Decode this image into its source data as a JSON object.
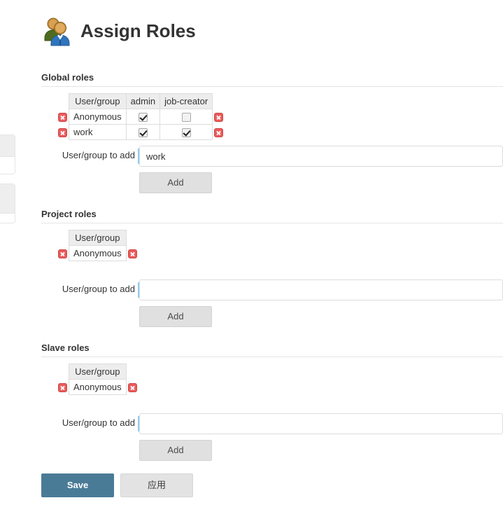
{
  "page": {
    "title": "Assign Roles",
    "icon": "users-group-icon"
  },
  "sections": [
    {
      "id": "global",
      "title": "Global roles",
      "columns": [
        "User/group",
        "admin",
        "job-creator"
      ],
      "rows": [
        {
          "user": "Anonymous",
          "checks": [
            true,
            false
          ]
        },
        {
          "user": "work",
          "checks": [
            true,
            true
          ]
        }
      ],
      "add_label": "User/group to add",
      "add_value": "work",
      "add_placeholder": "",
      "add_button": "Add"
    },
    {
      "id": "project",
      "title": "Project roles",
      "columns": [
        "User/group"
      ],
      "rows": [
        {
          "user": "Anonymous",
          "checks": []
        }
      ],
      "add_label": "User/group to add",
      "add_value": "",
      "add_placeholder": "",
      "add_button": "Add"
    },
    {
      "id": "slave",
      "title": "Slave roles",
      "columns": [
        "User/group"
      ],
      "rows": [
        {
          "user": "Anonymous",
          "checks": []
        }
      ],
      "add_label": "User/group to add",
      "add_value": "",
      "add_placeholder": "",
      "add_button": "Add"
    }
  ],
  "footer": {
    "save_label": "Save",
    "apply_label": "应用"
  },
  "colors": {
    "primary_button": "#4a7b96",
    "secondary_button": "#e3e3e3",
    "delete_icon": "#ea5b5b",
    "table_header": "#ededed",
    "border": "#dcdcdc",
    "focus_accent": "#8ecdf2"
  }
}
